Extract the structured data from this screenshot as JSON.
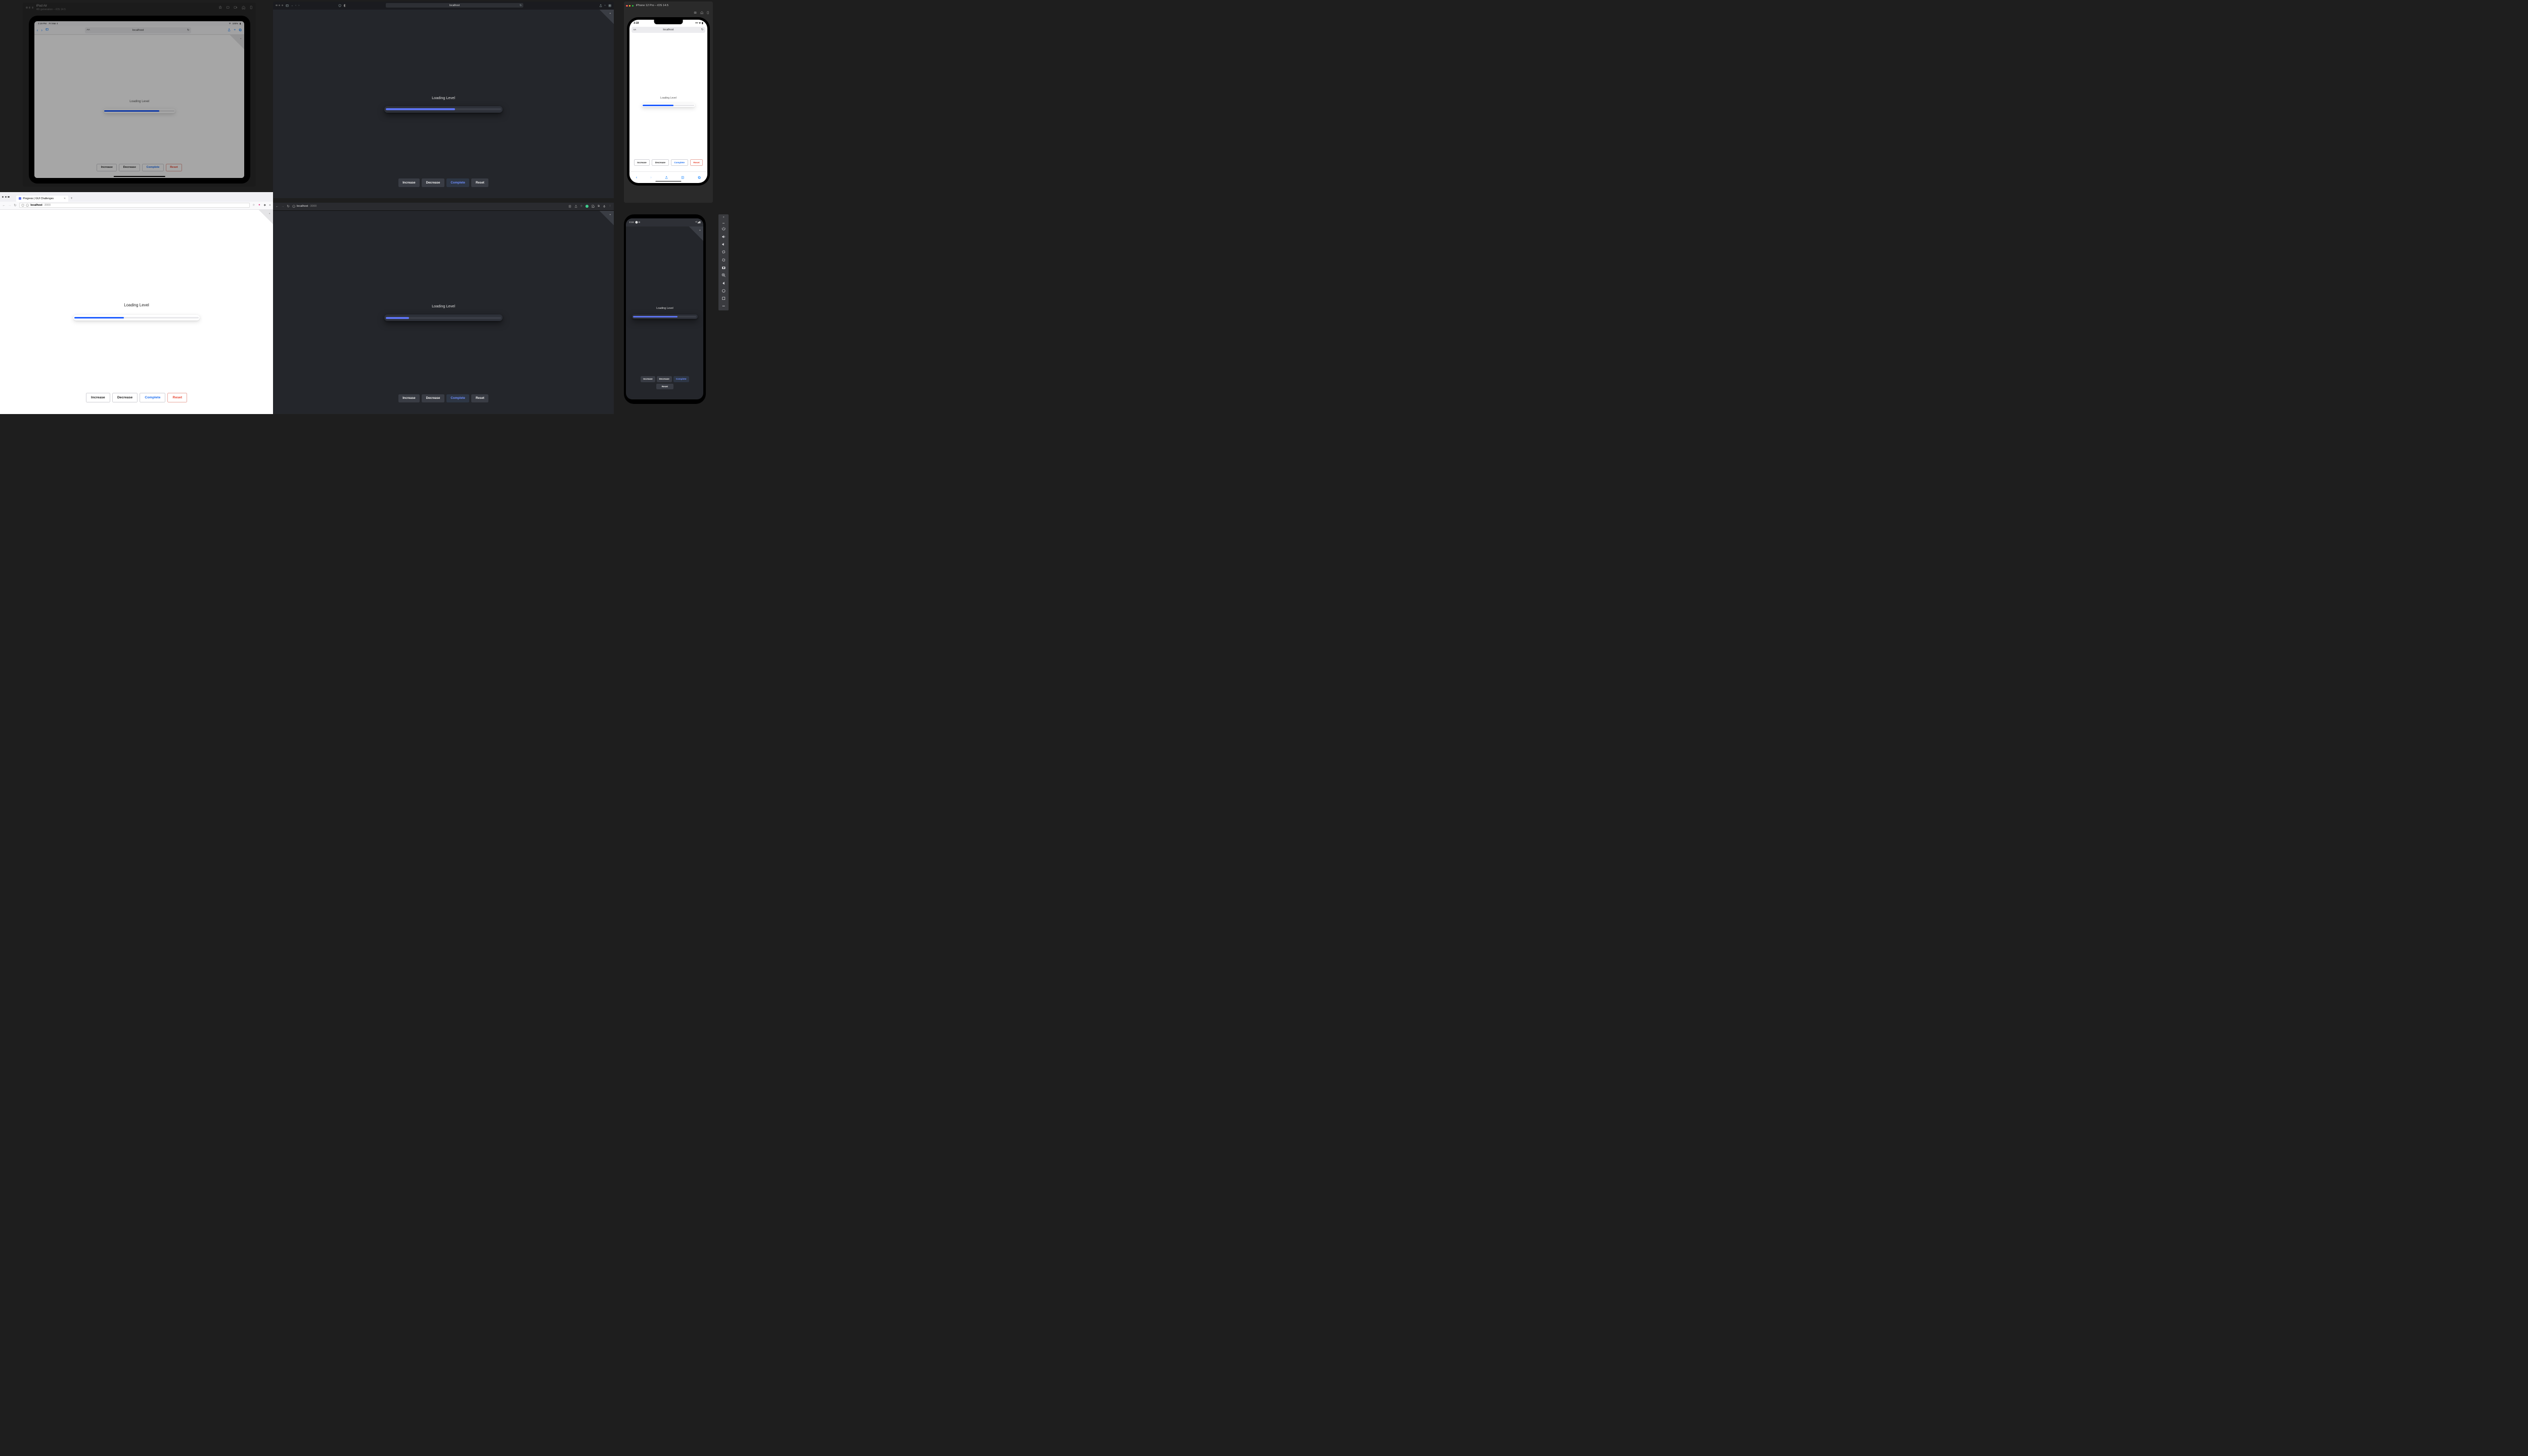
{
  "ipad": {
    "window_title": "iPad Air",
    "window_subtitle": "4th generation – iOS 14.5",
    "status_time": "3:19 PM",
    "status_date": "Fri Mar 4",
    "status_battery": "100%",
    "url": "localhost",
    "demo": {
      "label": "Loading Level",
      "progress_pct": 78,
      "buttons": {
        "increase": "Increase",
        "decrease": "Decrease",
        "complete": "Complete",
        "reset": "Reset"
      }
    }
  },
  "safari": {
    "url": "localhost",
    "demo": {
      "label": "Loading Level",
      "progress_pct": 60,
      "buttons": {
        "increase": "Increase",
        "decrease": "Decrease",
        "complete": "Complete",
        "reset": "Reset"
      }
    }
  },
  "iphone": {
    "window_title": "iPhone 12 Pro – iOS 14.5",
    "status_time": "3:19",
    "url": "localhost",
    "demo": {
      "label": "Loading Level",
      "progress_pct": 60,
      "buttons": {
        "increase": "Increase",
        "decrease": "Decrease",
        "complete": "Complete",
        "reset": "Reset"
      }
    }
  },
  "firefox": {
    "tab_title": "Progress | GUI Challenges",
    "host": "localhost",
    "port": ":3000",
    "demo": {
      "label": "Loading Level",
      "progress_pct": 40,
      "buttons": {
        "increase": "Increase",
        "decrease": "Decrease",
        "complete": "Complete",
        "reset": "Reset"
      }
    }
  },
  "chrome": {
    "host": "localhost",
    "port": ":3000",
    "demo": {
      "label": "Loading Level",
      "progress_pct": 20,
      "buttons": {
        "increase": "Increase",
        "decrease": "Decrease",
        "complete": "Complete",
        "reset": "Reset"
      }
    }
  },
  "android": {
    "status_time": "3:19",
    "status_icon": "B",
    "demo": {
      "label": "Loading Level",
      "progress_pct": 70,
      "buttons": {
        "increase": "Increase",
        "decrease": "Decrease",
        "complete": "Complete",
        "reset": "Reset"
      }
    }
  }
}
